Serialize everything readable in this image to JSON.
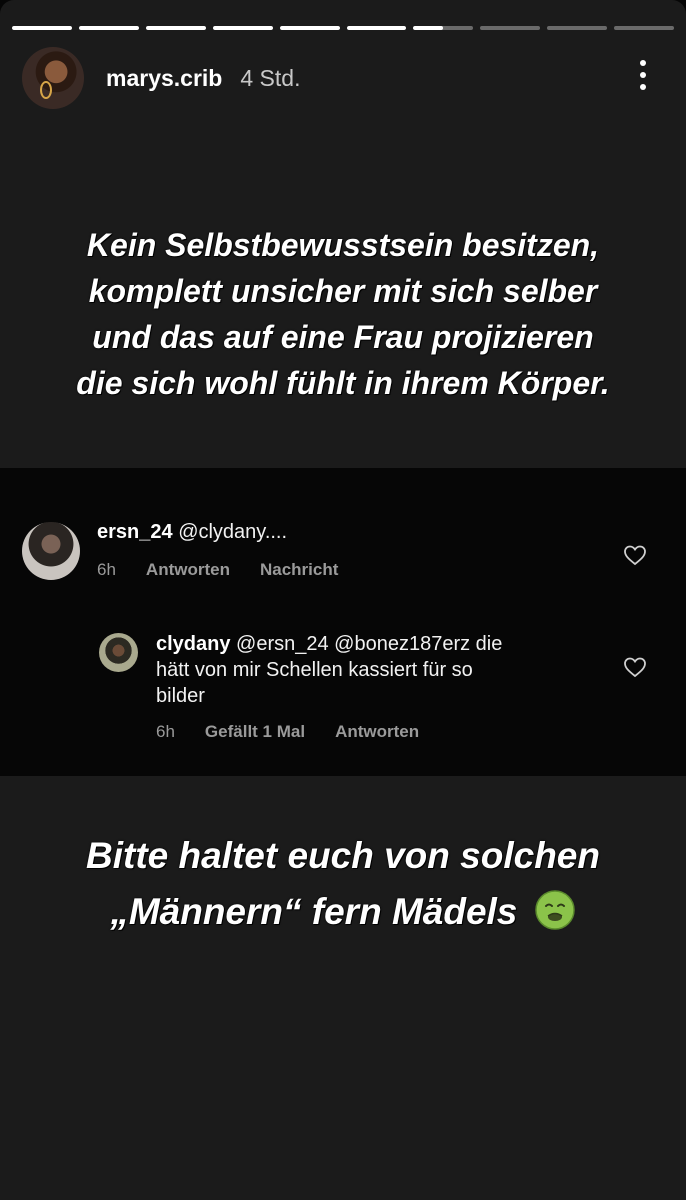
{
  "story": {
    "progress_segments": [
      1,
      1,
      1,
      1,
      1,
      1,
      0.5,
      0,
      0,
      0
    ],
    "username": "marys.crib",
    "time": "4 Std.",
    "text_top": [
      "Kein Selbstbewusstsein besitzen,",
      "komplett unsicher mit sich selber",
      "und das auf eine Frau projizieren",
      "die sich wohl fühlt in ihrem Körper."
    ],
    "text_bottom": [
      "Bitte haltet euch von solchen",
      "„Männern“ fern Mädels"
    ],
    "emoji": "nauseated-face-icon"
  },
  "comments": [
    {
      "user": "ersn_24",
      "text": "@clydany....",
      "age": "6h",
      "actions": [
        "Antworten",
        "Nachricht"
      ]
    },
    {
      "user": "clydany",
      "text_lines": [
        "@ersn_24 @bonez187erz die",
        "hätt von mir Schellen kassiert für so",
        "bilder"
      ],
      "age": "6h",
      "likes": "Gefällt 1 Mal",
      "actions": [
        "Antworten"
      ]
    }
  ],
  "colors": {
    "top_panel": "#1b1b1b",
    "background": "#060606",
    "meta_text": "#9a9a9a"
  }
}
